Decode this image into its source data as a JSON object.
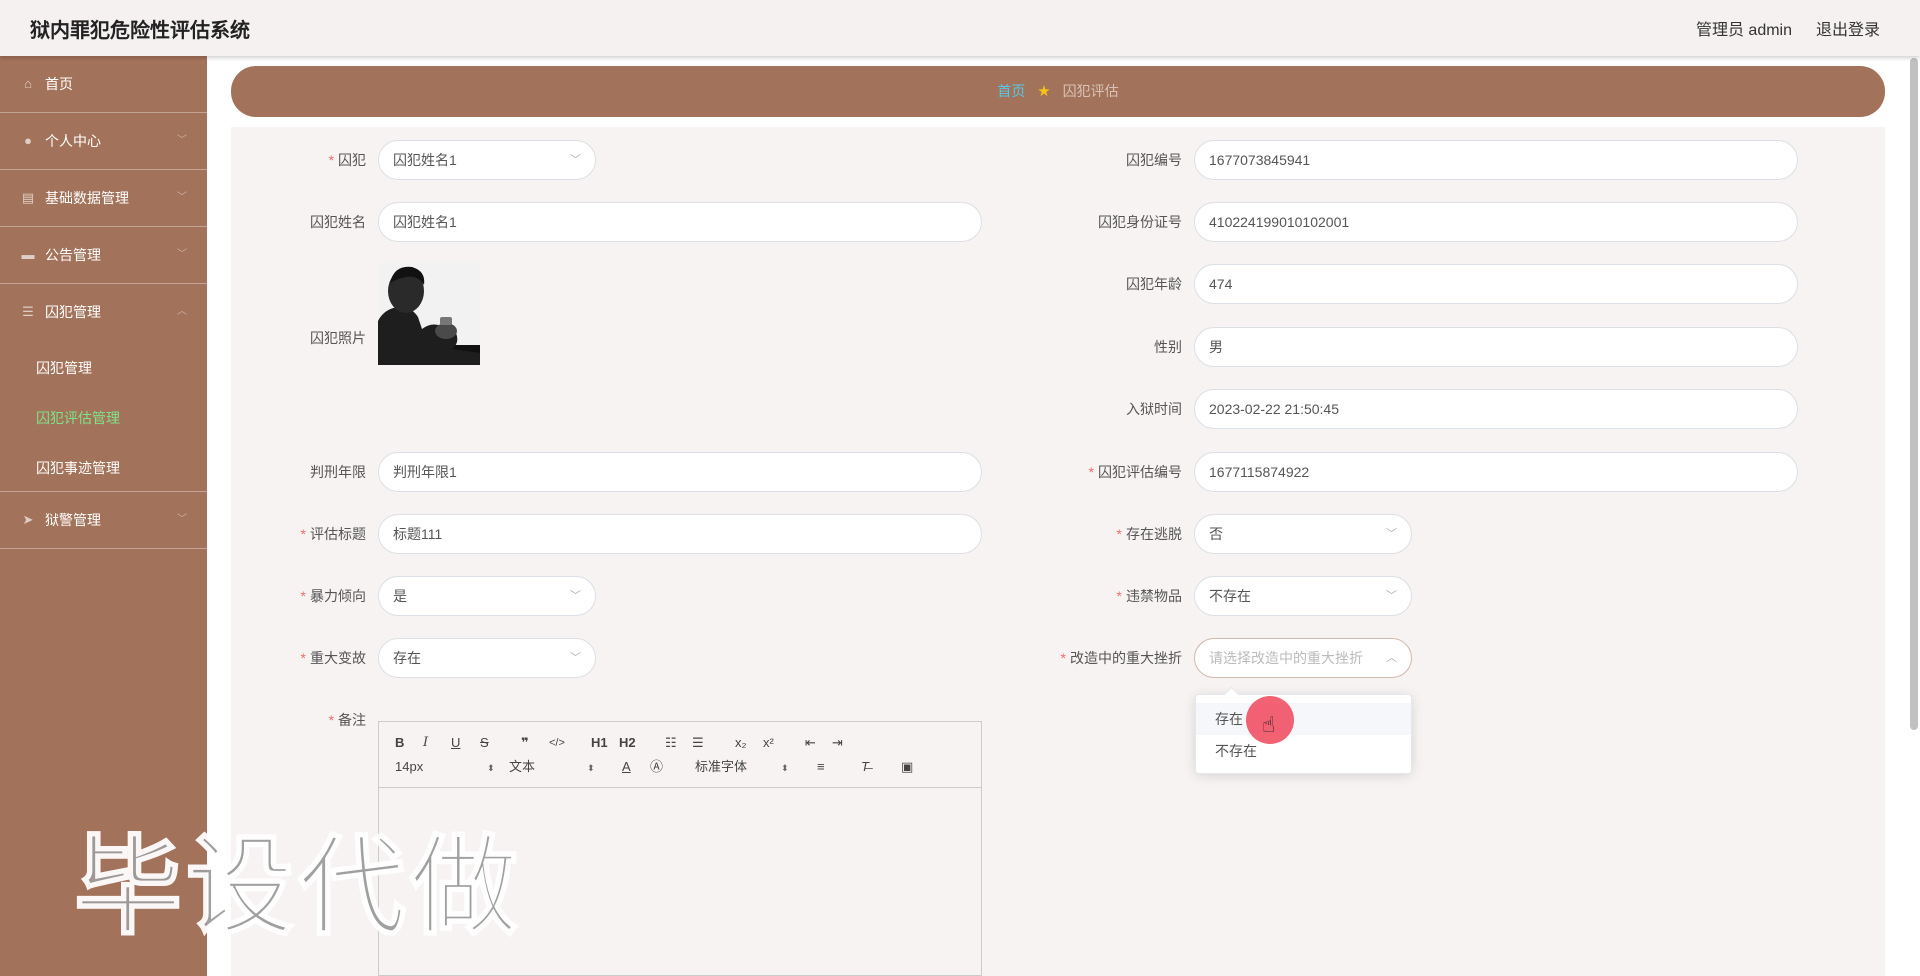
{
  "header": {
    "title": "狱内罪犯危险性评估系统",
    "admin": "管理员 admin",
    "logout": "退出登录"
  },
  "sidebar": {
    "items": [
      {
        "label": "首页",
        "icon": "home-icon"
      },
      {
        "label": "个人中心",
        "icon": "user-icon"
      },
      {
        "label": "基础数据管理",
        "icon": "database-icon"
      },
      {
        "label": "公告管理",
        "icon": "monitor-icon"
      },
      {
        "label": "囚犯管理",
        "icon": "list-icon"
      },
      {
        "label": "狱警管理",
        "icon": "send-icon"
      }
    ],
    "sub_items": [
      {
        "label": "囚犯管理"
      },
      {
        "label": "囚犯评估管理"
      },
      {
        "label": "囚犯事迹管理"
      }
    ]
  },
  "breadcrumb": {
    "home": "首页",
    "current": "囚犯评估"
  },
  "form": {
    "prisoner": {
      "label": "囚犯",
      "value": "囚犯姓名1"
    },
    "prisoner_no": {
      "label": "囚犯编号",
      "value": "1677073845941"
    },
    "prisoner_name": {
      "label": "囚犯姓名",
      "value": "囚犯姓名1"
    },
    "id_card": {
      "label": "囚犯身份证号",
      "value": "410224199010102001"
    },
    "age": {
      "label": "囚犯年龄",
      "value": "474"
    },
    "photo": {
      "label": "囚犯照片"
    },
    "gender": {
      "label": "性别",
      "value": "男"
    },
    "entry_time": {
      "label": "入狱时间",
      "value": "2023-02-22 21:50:45"
    },
    "sentence": {
      "label": "判刑年限",
      "value": "判刑年限1"
    },
    "eval_no": {
      "label": "囚犯评估编号",
      "value": "1677115874922"
    },
    "eval_title": {
      "label": "评估标题",
      "value": "标题111"
    },
    "escape": {
      "label": "存在逃脱",
      "value": "否"
    },
    "violence": {
      "label": "暴力倾向",
      "value": "是"
    },
    "contraband": {
      "label": "违禁物品",
      "value": "不存在"
    },
    "major_change": {
      "label": "重大变故",
      "value": "存在"
    },
    "setback": {
      "label": "改造中的重大挫折",
      "placeholder": "请选择改造中的重大挫折"
    },
    "remark": {
      "label": "备注"
    }
  },
  "dropdown": {
    "options": [
      "存在",
      "不存在"
    ]
  },
  "editor": {
    "font_size": "14px",
    "block": "文本",
    "font_family": "标准字体",
    "buttons": [
      "B",
      "I",
      "U",
      "S",
      "❞",
      "</>",
      "H1",
      "H2",
      "x₂",
      "x²"
    ]
  },
  "watermark": "毕设代做"
}
